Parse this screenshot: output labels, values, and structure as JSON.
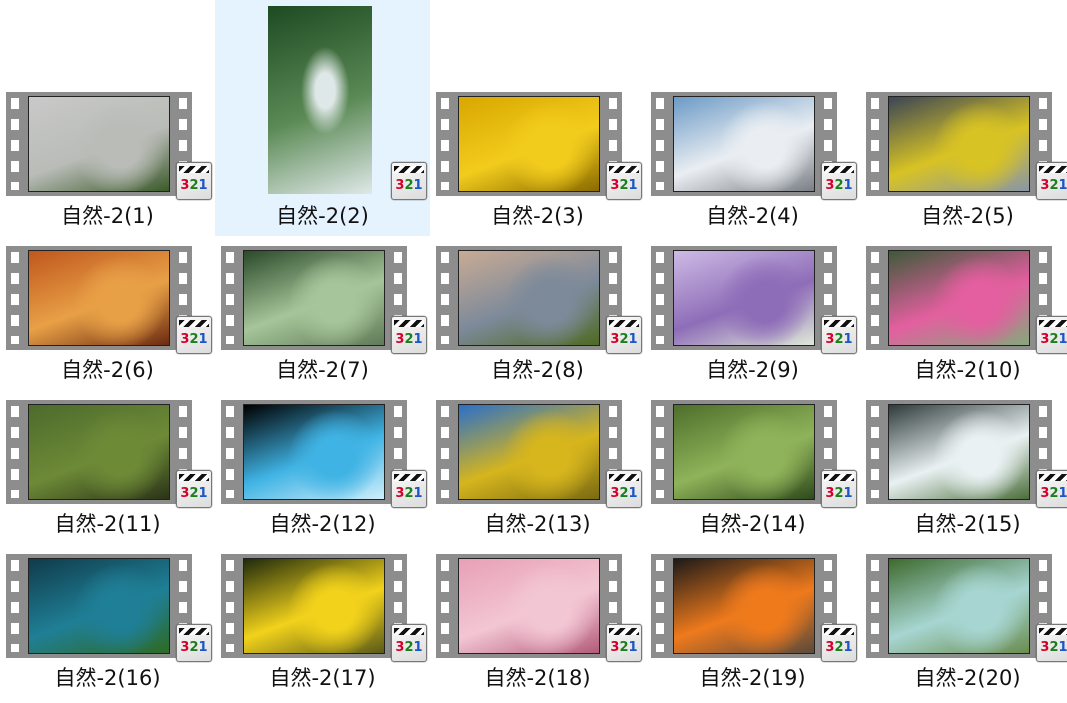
{
  "files": [
    {
      "name": "自然-2(1)",
      "icon": "film-video-icon",
      "preview": "plant-in-glass-jar-rain",
      "colors": [
        "#c9c9c9",
        "#b9bcb7",
        "#3b5a2a"
      ]
    },
    {
      "name": "自然-2(2)",
      "icon": "film-video-icon",
      "preview": "forest-waterfall",
      "colors": [
        "#1e4a22",
        "#5b8a55",
        "#dfe8e8"
      ]
    },
    {
      "name": "自然-2(3)",
      "icon": "film-video-icon",
      "preview": "yellow-forsythia",
      "colors": [
        "#d8a700",
        "#f2cc1d",
        "#8a6a00"
      ]
    },
    {
      "name": "自然-2(4)",
      "icon": "film-video-icon",
      "preview": "snow-mountain",
      "colors": [
        "#6c9ac6",
        "#eaeef2",
        "#7a7f86"
      ]
    },
    {
      "name": "自然-2(5)",
      "icon": "film-video-icon",
      "preview": "yellow-leaves-stream",
      "colors": [
        "#3b4556",
        "#d8c324",
        "#8896a6"
      ]
    },
    {
      "name": "自然-2(6)",
      "icon": "film-video-icon",
      "preview": "autumn-birch-forest",
      "colors": [
        "#c0571e",
        "#e8a046",
        "#6b2a11"
      ]
    },
    {
      "name": "自然-2(7)",
      "icon": "film-video-icon",
      "preview": "misty-forest-river",
      "colors": [
        "#2b4a2a",
        "#a6c59a",
        "#5f7a57"
      ]
    },
    {
      "name": "自然-2(8)",
      "icon": "film-video-icon",
      "preview": "bird-on-moss",
      "colors": [
        "#c9ab94",
        "#7d8a9a",
        "#4e6a22"
      ]
    },
    {
      "name": "自然-2(9)",
      "icon": "film-video-icon",
      "preview": "purple-flowers",
      "colors": [
        "#cdbbe5",
        "#8e6db8",
        "#dfe9d8"
      ]
    },
    {
      "name": "自然-2(10)",
      "icon": "film-video-icon",
      "preview": "pink-water-lilies",
      "colors": [
        "#3e5a3a",
        "#e35f9f",
        "#86a77c"
      ]
    },
    {
      "name": "自然-2(11)",
      "icon": "film-video-icon",
      "preview": "chamois-in-meadow",
      "colors": [
        "#4d6b2c",
        "#6d8a37",
        "#2b3318"
      ]
    },
    {
      "name": "自然-2(12)",
      "icon": "film-video-icon",
      "preview": "ship-on-waves",
      "colors": [
        "#000000",
        "#3fb3e4",
        "#cfeefb"
      ]
    },
    {
      "name": "自然-2(13)",
      "icon": "film-video-icon",
      "preview": "sunflower-field",
      "colors": [
        "#2a6fc9",
        "#d6b51d",
        "#7a6a12"
      ]
    },
    {
      "name": "自然-2(14)",
      "icon": "film-video-icon",
      "preview": "bee-eater-on-wire",
      "colors": [
        "#4d6f2b",
        "#8fb35a",
        "#2e4a1c"
      ]
    },
    {
      "name": "自然-2(15)",
      "icon": "film-video-icon",
      "preview": "waterfall-rainbow",
      "colors": [
        "#2f3b3a",
        "#e9f1f3",
        "#4b6e3a"
      ]
    },
    {
      "name": "自然-2(16)",
      "icon": "film-video-icon",
      "preview": "underwater-fish-school",
      "colors": [
        "#103b4b",
        "#1f7f96",
        "#2e6a23"
      ]
    },
    {
      "name": "自然-2(17)",
      "icon": "film-video-icon",
      "preview": "yellow-cosmos-flowers",
      "colors": [
        "#1f2a0c",
        "#f2d21b",
        "#5a5a18"
      ]
    },
    {
      "name": "自然-2(18)",
      "icon": "film-video-icon",
      "preview": "pink-cherry-blossoms",
      "colors": [
        "#e8a0b6",
        "#f3c6d4",
        "#b35b7a"
      ]
    },
    {
      "name": "自然-2(19)",
      "icon": "film-video-icon",
      "preview": "campfire-at-night",
      "colors": [
        "#1d1a18",
        "#ef7a1c",
        "#5b4a3b"
      ]
    },
    {
      "name": "自然-2(20)",
      "icon": "film-video-icon",
      "preview": "forest-creek",
      "colors": [
        "#3e6a2e",
        "#a7d6d2",
        "#6a8c4e"
      ]
    }
  ],
  "badge": {
    "d3": "3",
    "d2": "2",
    "d1": "1"
  },
  "selected_index": 1
}
